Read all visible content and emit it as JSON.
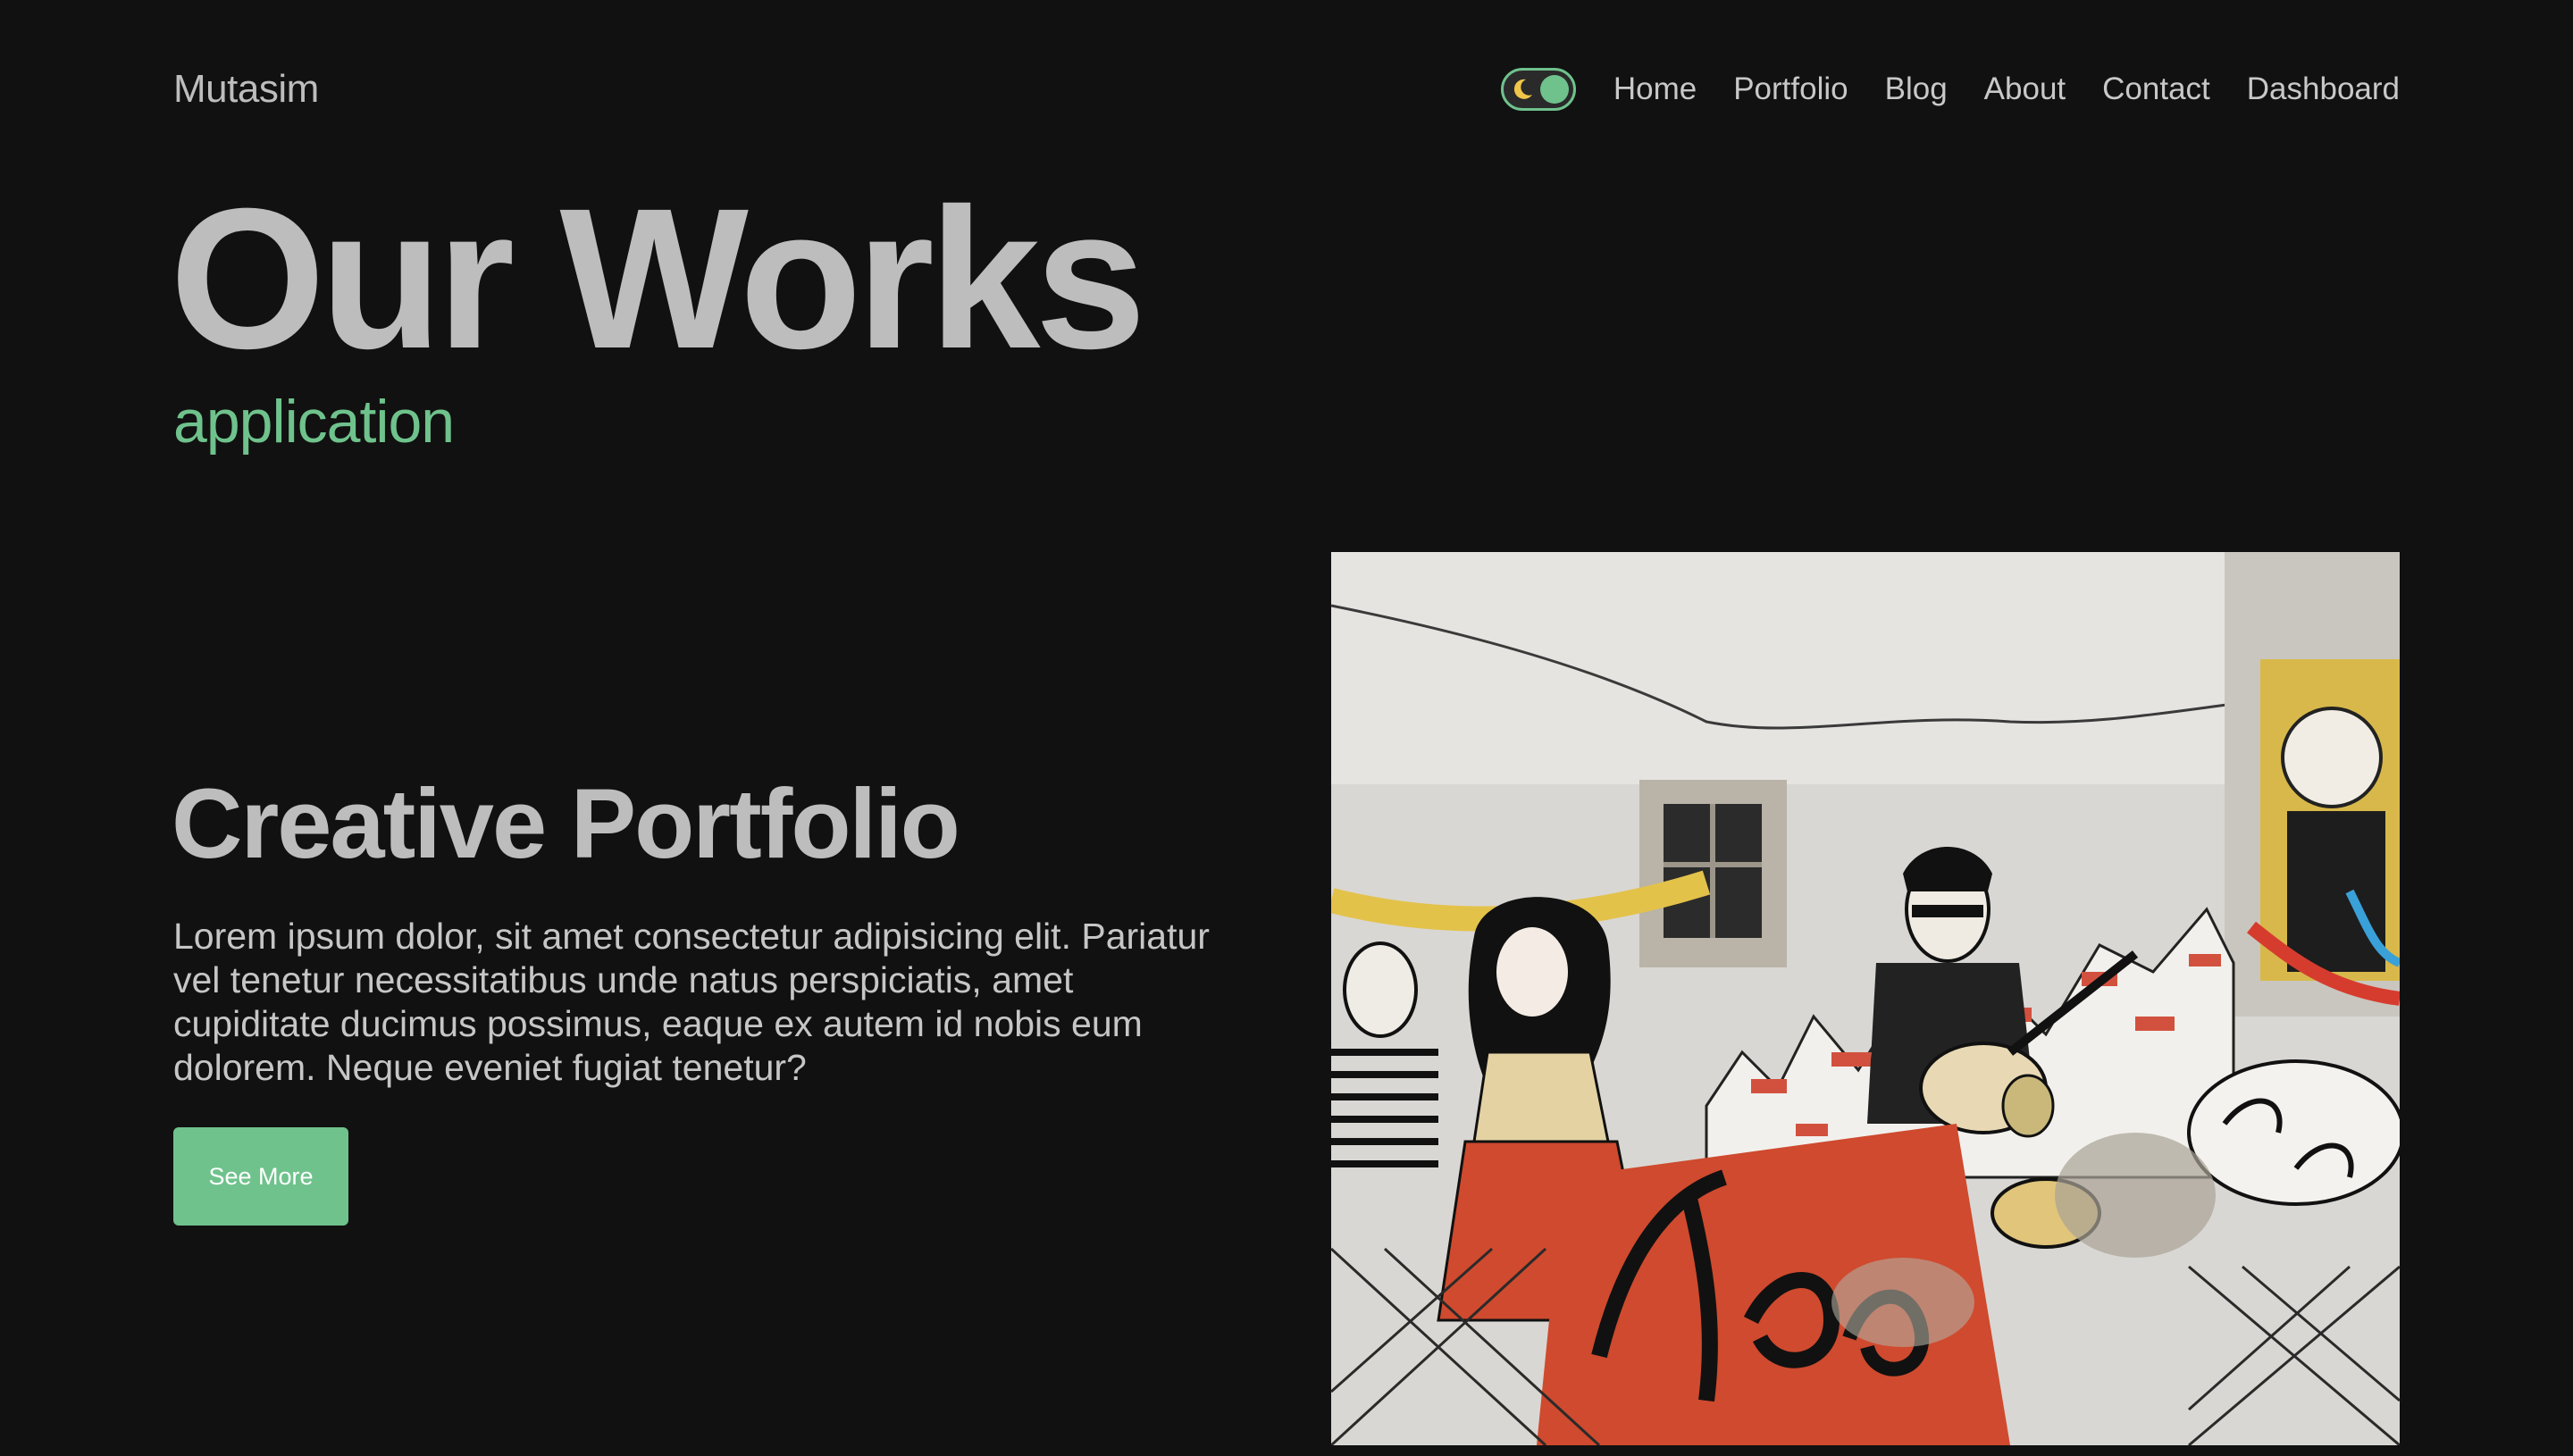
{
  "brand": {
    "name": "Mutasim"
  },
  "nav": {
    "links": [
      "Home",
      "Portfolio",
      "Blog",
      "About",
      "Contact",
      "Dashboard"
    ],
    "theme_toggle": {
      "icon": "moon-icon",
      "state": "on"
    }
  },
  "hero": {
    "title": "Our Works",
    "subtitle": "application"
  },
  "project": {
    "title": "Creative Portfolio",
    "description": "Lorem ipsum dolor, sit amet consectetur adipisicing elit. Pariatur vel tenetur necessitatibus unde natus perspiciatis, amet cupiditate ducimus possimus, eaque ex autem id nobis eum dolorem. Neque eveniet fugiat tenetur?",
    "button_label": "See More"
  },
  "colors": {
    "background": "#111111",
    "accent": "#6fc28c",
    "text": "#bdbdbd"
  }
}
